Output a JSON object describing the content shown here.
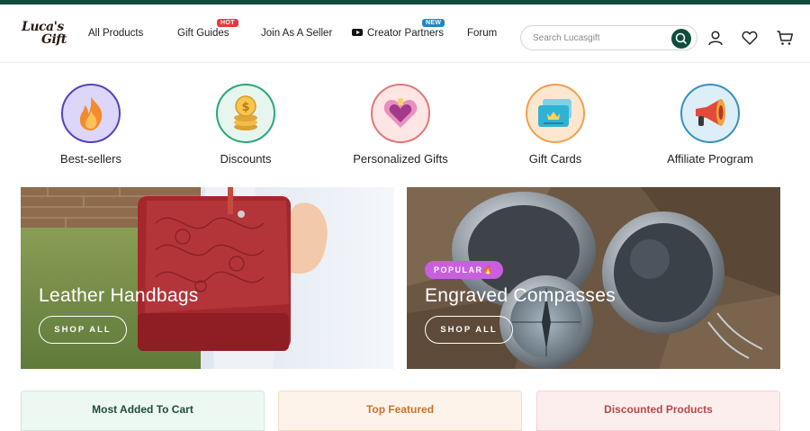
{
  "header": {
    "logo_line1": "Luca's",
    "logo_line2": "Gift",
    "nav": [
      {
        "label": "All Products"
      },
      {
        "label": "Gift Guides",
        "badge": "HOT"
      },
      {
        "label": "Join As A Seller"
      },
      {
        "label": "Creator Partners",
        "badge": "NEW",
        "icon": "youtube-icon"
      },
      {
        "label": "Forum"
      }
    ],
    "search_placeholder": "Search Lucasgift",
    "icons": [
      "search-icon",
      "user-icon",
      "heart-icon",
      "cart-icon"
    ],
    "brand_color": "#0f4d3c"
  },
  "categories": [
    {
      "label": "Best-sellers",
      "icon": "fire-icon",
      "border": "#5b3fb8",
      "bg": "#dcd6fb"
    },
    {
      "label": "Discounts",
      "icon": "coins-icon",
      "border": "#2aa57f",
      "bg": "#e6f6ef"
    },
    {
      "label": "Personalized Gifts",
      "icon": "heart-gift-icon",
      "border": "#e0787a",
      "bg": "#fde6e4"
    },
    {
      "label": "Gift Cards",
      "icon": "gift-card-icon",
      "border": "#f0a050",
      "bg": "#fde7cf"
    },
    {
      "label": "Affiliate Program",
      "icon": "megaphone-icon",
      "border": "#3a8fc0",
      "bg": "#dceef8"
    }
  ],
  "banners": [
    {
      "title": "Leather Handbags",
      "cta": "SHOP ALL"
    },
    {
      "title": "Engraved  Compasses",
      "cta": "SHOP ALL",
      "tag": "POPULAR🔥"
    }
  ],
  "bottom_sections": [
    {
      "label": "Most Added To Cart",
      "color": "#1d4d3d",
      "bg": "#eef8f2",
      "border": "#cfe8da"
    },
    {
      "label": "Top Featured",
      "color": "#c7742a",
      "bg": "#fdf3ea",
      "border": "#f4dcc4"
    },
    {
      "label": "Discounted Products",
      "color": "#b5474a",
      "bg": "#fdeeee",
      "border": "#f2d3d3"
    }
  ]
}
